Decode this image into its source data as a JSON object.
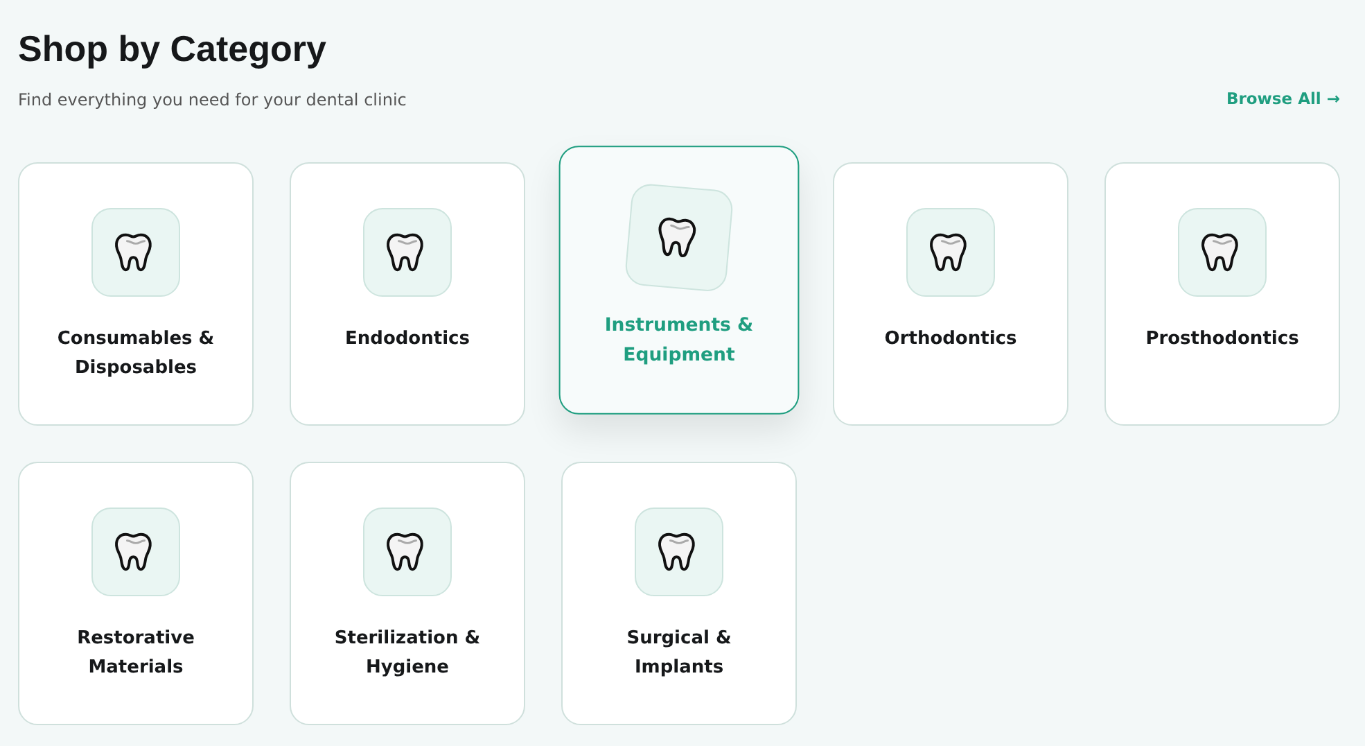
{
  "header": {
    "title": "Shop by Category",
    "subtitle": "Find everything you need for your dental clinic",
    "link": "Browse All →"
  },
  "categories": [
    {
      "name": "Consumables & Disposables",
      "selected": false
    },
    {
      "name": "Endodontics",
      "selected": false
    },
    {
      "name": "Instruments & Equipment",
      "selected": true
    },
    {
      "name": "Orthodontics",
      "selected": false
    },
    {
      "name": "Prosthodontics",
      "selected": false
    },
    {
      "name": "Restorative Materials",
      "selected": false
    },
    {
      "name": "Sterilization & Hygiene",
      "selected": false
    },
    {
      "name": "Surgical & Implants",
      "selected": false
    }
  ]
}
